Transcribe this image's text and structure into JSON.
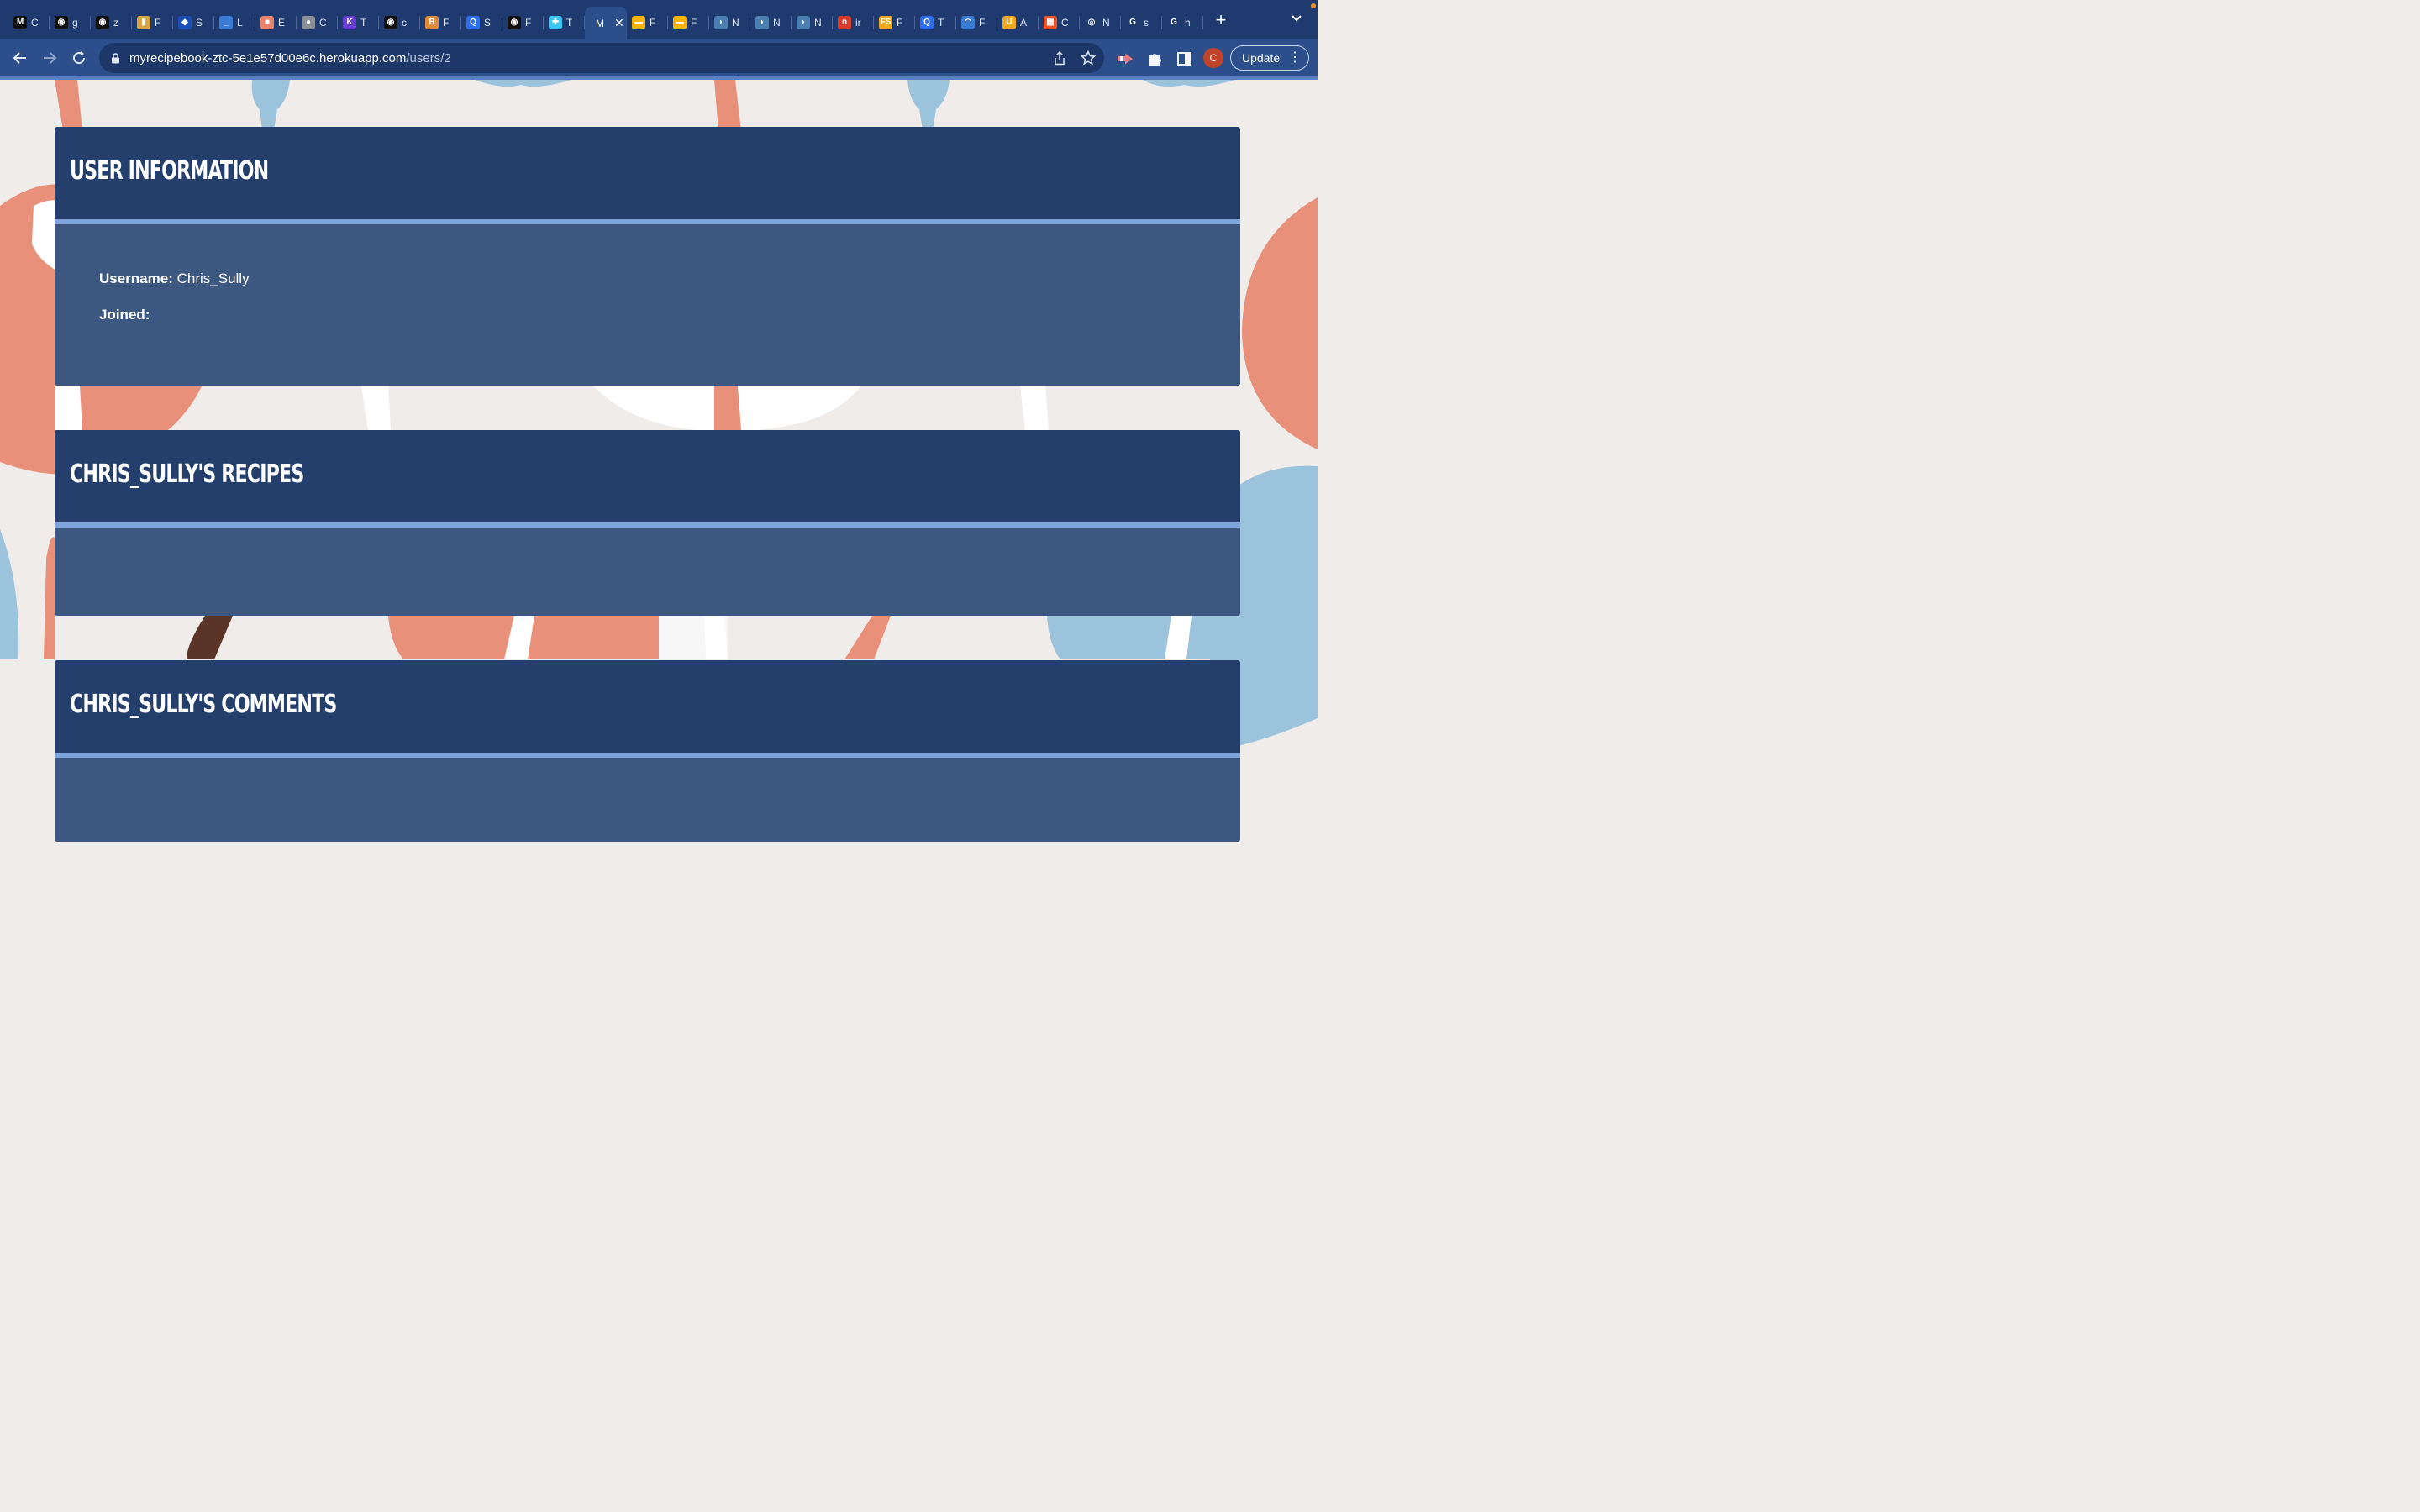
{
  "browser": {
    "tabs": [
      {
        "icon": "medium-icon",
        "color": "#111111",
        "glyph": "M",
        "label": "C"
      },
      {
        "icon": "github-icon",
        "color": "#111111",
        "glyph": "◉",
        "label": "g"
      },
      {
        "icon": "github-icon",
        "color": "#111111",
        "glyph": "◉",
        "label": "z"
      },
      {
        "icon": "bottle-icon",
        "color": "#d9a441",
        "glyph": "▮",
        "label": "F"
      },
      {
        "icon": "shield-icon",
        "color": "#1b4fb8",
        "glyph": "◆",
        "label": "S"
      },
      {
        "icon": "underline-icon",
        "color": "#3a7bd5",
        "glyph": "_",
        "label": "L"
      },
      {
        "icon": "gradient-icon",
        "color": "#e9836a",
        "glyph": "■",
        "label": "E"
      },
      {
        "icon": "globe-icon",
        "color": "#8a8f98",
        "glyph": "●",
        "label": "C"
      },
      {
        "icon": "k-icon",
        "color": "#6a3fd8",
        "glyph": "K",
        "label": "T"
      },
      {
        "icon": "github-icon",
        "color": "#111111",
        "glyph": "◉",
        "label": "c"
      },
      {
        "icon": "b-icon",
        "color": "#e08a3c",
        "glyph": "B",
        "label": "F"
      },
      {
        "icon": "q-icon",
        "color": "#2d6ef0",
        "glyph": "Q",
        "label": "S"
      },
      {
        "icon": "github-icon",
        "color": "#111111",
        "glyph": "◉",
        "label": "F"
      },
      {
        "icon": "slack-icon",
        "color": "#36c5f0",
        "glyph": "✚",
        "label": "T"
      },
      {
        "icon": "mail-icon",
        "color": "#f4b400",
        "glyph": "▬",
        "label": "F"
      },
      {
        "icon": "mail-icon",
        "color": "#f4b400",
        "glyph": "▬",
        "label": "F"
      },
      {
        "icon": "leaf-icon",
        "color": "#4a7fb0",
        "glyph": "◗",
        "label": "N"
      },
      {
        "icon": "leaf-icon",
        "color": "#4a7fb0",
        "glyph": "◗",
        "label": "N"
      },
      {
        "icon": "leaf-icon",
        "color": "#4a7fb0",
        "glyph": "◗",
        "label": "N"
      },
      {
        "icon": "n-icon",
        "color": "#d63b2b",
        "glyph": "n",
        "label": "ir"
      },
      {
        "icon": "fs-icon",
        "color": "#f0a81c",
        "glyph": "FS",
        "label": "F"
      },
      {
        "icon": "q-icon",
        "color": "#2d6ef0",
        "glyph": "Q",
        "label": "T"
      },
      {
        "icon": "wave-icon",
        "color": "#3a7bd5",
        "glyph": "◠",
        "label": "F"
      },
      {
        "icon": "u-icon",
        "color": "#f0a81c",
        "glyph": "U",
        "label": "A"
      },
      {
        "icon": "windows-icon",
        "color": "#f25022",
        "glyph": "▦",
        "label": "C"
      },
      {
        "icon": "chrome-icon",
        "color": "#ffffff",
        "glyph": "◎",
        "label": "N"
      },
      {
        "icon": "google-icon",
        "color": "#ffffff",
        "glyph": "G",
        "label": "s"
      },
      {
        "icon": "google-icon",
        "color": "#ffffff",
        "glyph": "G",
        "label": "h"
      }
    ],
    "active_tab": {
      "label": "M"
    },
    "url_host": "myrecipebook-ztc-5e1e57d00e6c.herokuapp.com",
    "url_path": "/users/2",
    "profile_initial": "C",
    "update_label": "Update"
  },
  "page": {
    "user_info": {
      "heading": "USER INFORMATION",
      "username_label": "Username:",
      "username_value": "Chris_Sully",
      "joined_label": "Joined:",
      "joined_value": ""
    },
    "recipes": {
      "heading": "CHRIS_SULLY'S RECIPES"
    },
    "comments": {
      "heading": "CHRIS_SULLY'S COMMENTS"
    }
  },
  "colors": {
    "chrome": "#1e3a6e",
    "card_header": "#243f6b",
    "card_body": "#3c5780",
    "card_rule": "#7fa4dc",
    "bg_coral": "#e8907a",
    "bg_blue": "#9cc3dc"
  }
}
